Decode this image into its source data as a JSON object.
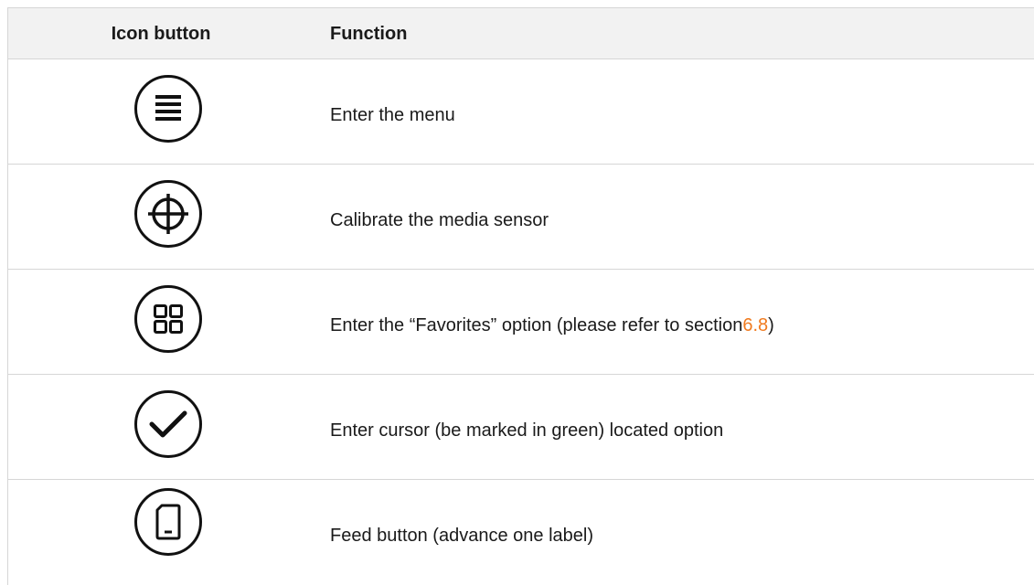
{
  "table": {
    "header": {
      "icon_col": "Icon button",
      "function_col": "Function"
    },
    "rows": [
      {
        "icon": "menu-icon",
        "function": "Enter the menu"
      },
      {
        "icon": "calibrate-crosshair-icon",
        "function": "Calibrate the media sensor"
      },
      {
        "icon": "favorites-grid-icon",
        "function_before": "Enter the “Favorites” option (please refer to section ",
        "function_link": "6.8",
        "function_after": ")"
      },
      {
        "icon": "checkmark-icon",
        "function": "Enter cursor (be marked in green) located option"
      },
      {
        "icon": "feed-label-icon",
        "function": "Feed button (advance one label)"
      }
    ]
  },
  "colors": {
    "header_bg": "#f2f2f2",
    "rule": "#d6d6d6",
    "link": "#f07a1e",
    "text": "#1a1a1a"
  }
}
